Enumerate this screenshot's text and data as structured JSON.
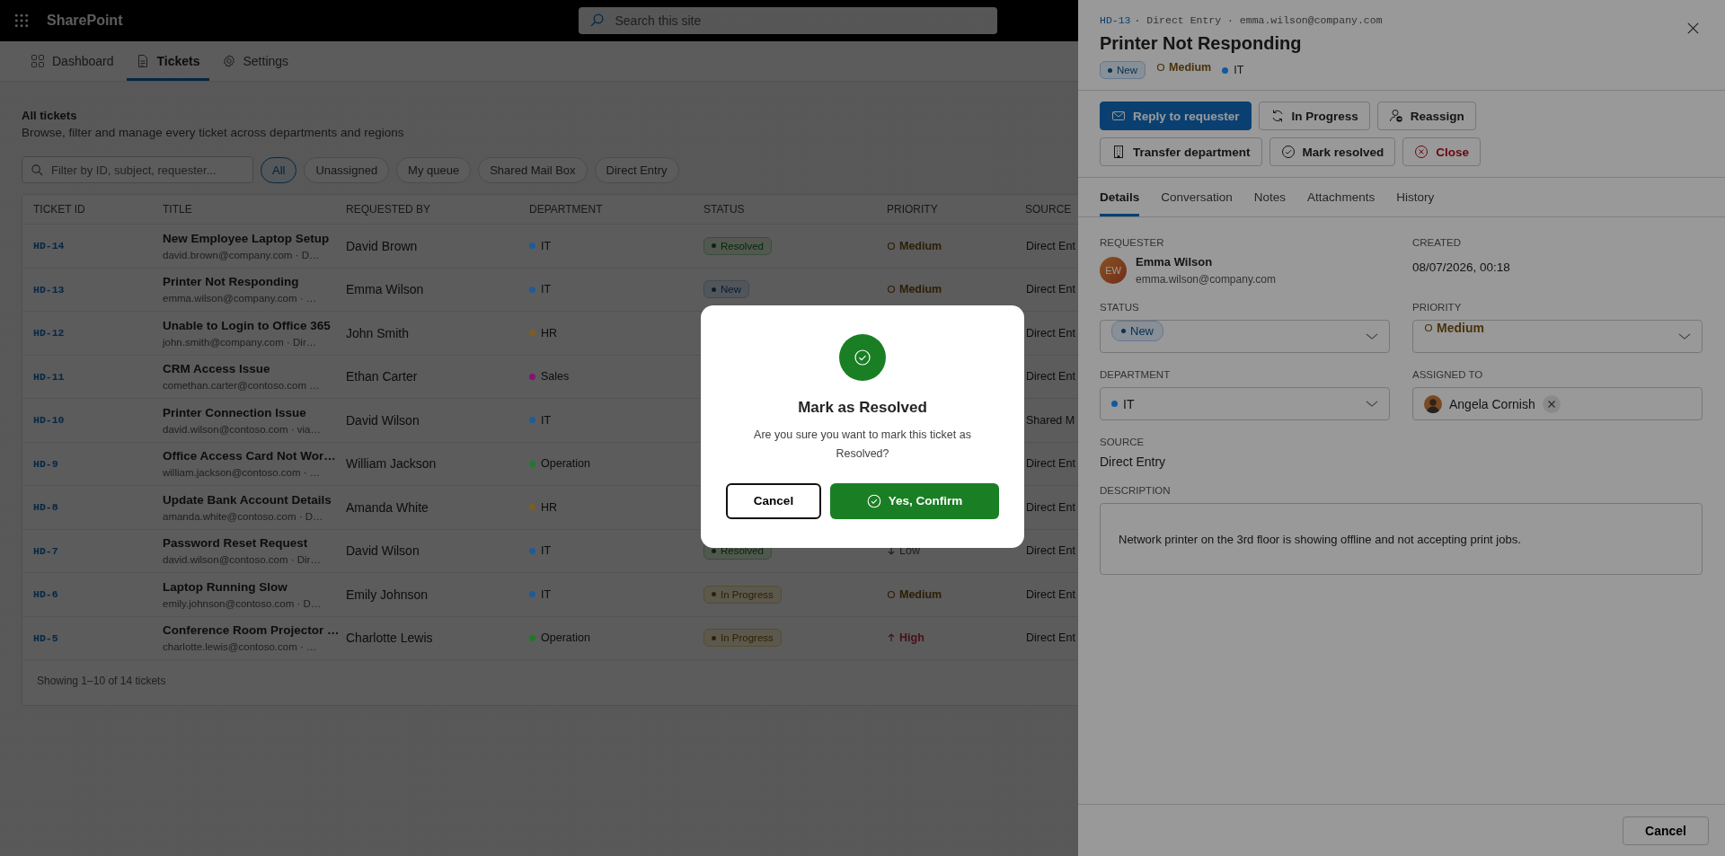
{
  "app_bar": {
    "app_name": "SharePoint",
    "search": {
      "placeholder": "Search this site"
    }
  },
  "nav_tabs": [
    {
      "label": "Dashboard",
      "kind": "dashboard",
      "selected": false
    },
    {
      "label": "Tickets",
      "kind": "tickets",
      "selected": true
    },
    {
      "label": "Settings",
      "kind": "settings",
      "selected": false
    }
  ],
  "page": {
    "title": "All tickets",
    "subtitle": "Browse, filter and manage every ticket across departments and regions"
  },
  "filter": {
    "placeholder": "Filter by ID, subject, requester..."
  },
  "chips": [
    {
      "label": "All",
      "selected": true
    },
    {
      "label": "Unassigned",
      "selected": false
    },
    {
      "label": "My queue",
      "selected": false
    },
    {
      "label": "Shared Mail Box",
      "selected": false
    },
    {
      "label": "Direct Entry",
      "selected": false
    }
  ],
  "table": {
    "columns": [
      "TICKET ID",
      "TITLE",
      "REQUESTED BY",
      "DEPARTMENT",
      "STATUS",
      "PRIORITY",
      "SOURCE"
    ],
    "rows": [
      {
        "id": "HD-14",
        "title": "New Employee Laptop Setup",
        "subtitle": "david.brown@company.com · D…",
        "requested_by": "David Brown",
        "department": {
          "label": "IT",
          "color": "#1d5c99"
        },
        "status": {
          "label": "Resolved",
          "kind": "resolved"
        },
        "priority": {
          "label": "Medium",
          "kind": "medium"
        },
        "source": "Direct Ent"
      },
      {
        "id": "HD-13",
        "title": "Printer Not Responding",
        "subtitle": "emma.wilson@company.com · …",
        "requested_by": "Emma Wilson",
        "department": {
          "label": "IT",
          "color": "#1d5c99"
        },
        "status": {
          "label": "New",
          "kind": "new"
        },
        "priority": {
          "label": "Medium",
          "kind": "medium"
        },
        "source": "Direct Ent"
      },
      {
        "id": "HD-12",
        "title": "Unable to Login to Office 365",
        "subtitle": "john.smith@company.com · Dir…",
        "requested_by": "John Smith",
        "department": {
          "label": "HR",
          "color": "#7a6020"
        },
        "source": "Direct Ent"
      },
      {
        "id": "HD-11",
        "title": "CRM Access Issue",
        "subtitle": "comethan.carter@contoso.com …",
        "requested_by": "Ethan Carter",
        "department": {
          "label": "Sales",
          "color": "#8a1070"
        },
        "source": "Direct Ent"
      },
      {
        "id": "HD-10",
        "title": "Printer Connection Issue",
        "subtitle": "david.wilson@contoso.com · via…",
        "requested_by": "David Wilson",
        "department": {
          "label": "IT",
          "color": "#1d5c99"
        },
        "source": "Shared M"
      },
      {
        "id": "HD-9",
        "title": "Office Access Card Not Wor…",
        "subtitle": "william.jackson@contoso.com · …",
        "requested_by": "William Jackson",
        "department": {
          "label": "Operation",
          "color": "#1d7a2a"
        },
        "source": "Direct Ent"
      },
      {
        "id": "HD-8",
        "title": "Update Bank Account Details",
        "subtitle": "amanda.white@contoso.com · D…",
        "requested_by": "Amanda White",
        "department": {
          "label": "HR",
          "color": "#7a6020"
        },
        "source": "Direct Ent"
      },
      {
        "id": "HD-7",
        "title": "Password Reset Request",
        "subtitle": "david.wilson@contoso.com · Dir…",
        "requested_by": "David Wilson",
        "department": {
          "label": "IT",
          "color": "#1d5c99"
        },
        "status": {
          "label": "Resolved",
          "kind": "resolved"
        },
        "priority": {
          "label": "Low",
          "kind": "low"
        },
        "source": "Direct Ent"
      },
      {
        "id": "HD-6",
        "title": "Laptop Running Slow",
        "subtitle": "emily.johnson@contoso.com · D…",
        "requested_by": "Emily Johnson",
        "department": {
          "label": "IT",
          "color": "#1d5c99"
        },
        "status": {
          "label": "In Progress",
          "kind": "in_progress"
        },
        "priority": {
          "label": "Medium",
          "kind": "medium"
        },
        "source": "Direct Ent"
      },
      {
        "id": "HD-5",
        "title": "Conference Room Projector …",
        "subtitle": "charlotte.lewis@contoso.com · …",
        "requested_by": "Charlotte Lewis",
        "department": {
          "label": "Operation",
          "color": "#1d7a2a"
        },
        "status": {
          "label": "In Progress",
          "kind": "in_progress"
        },
        "priority": {
          "label": "High",
          "kind": "high"
        },
        "source": "Direct Ent"
      }
    ],
    "footer": "Showing 1–10 of 14 tickets"
  },
  "drawer": {
    "ticket_id": "HD-13",
    "meta": "· Direct Entry · emma.wilson@company.com",
    "title": "Printer Not Responding",
    "badges": {
      "status": {
        "label": "New",
        "kind": "new"
      },
      "priority": {
        "label": "Medium",
        "kind": "medium"
      },
      "department": {
        "label": "IT",
        "color": "#0f5aa0"
      }
    },
    "actions": [
      {
        "label": "Reply to requester",
        "kind": "reply"
      },
      {
        "label": "In Progress",
        "kind": "progress"
      },
      {
        "label": "Reassign",
        "kind": "reassign"
      },
      {
        "label": "Transfer department",
        "kind": "transfer"
      },
      {
        "label": "Mark resolved",
        "kind": "resolve"
      },
      {
        "label": "Close",
        "kind": "close"
      }
    ],
    "tabs": [
      {
        "label": "Details",
        "selected": true
      },
      {
        "label": "Conversation",
        "selected": false
      },
      {
        "label": "Notes",
        "selected": false
      },
      {
        "label": "Attachments",
        "selected": false
      },
      {
        "label": "History",
        "selected": false
      }
    ],
    "requester": {
      "label": "REQUESTER",
      "initials": "EW",
      "name": "Emma Wilson",
      "email": "emma.wilson@company.com"
    },
    "created": {
      "label": "CREATED",
      "value": "08/07/2026, 00:18"
    },
    "status": {
      "label": "STATUS",
      "value": {
        "label": "New",
        "kind": "new"
      }
    },
    "priority": {
      "label": "PRIORITY",
      "value": {
        "label": "Medium",
        "kind": "medium"
      }
    },
    "department": {
      "label": "DEPARTMENT",
      "value": {
        "label": "IT",
        "color": "#0f5aa0"
      }
    },
    "assigned_to": {
      "label": "ASSIGNED TO",
      "name": "Angela Cornish"
    },
    "source": {
      "label": "SOURCE",
      "value": "Direct Entry"
    },
    "description": {
      "label": "DESCRIPTION",
      "value": "Network printer on the 3rd floor is showing offline and not accepting print jobs."
    },
    "footer_button": "Cancel"
  },
  "dialog": {
    "title": "Mark as Resolved",
    "message": "Are you sure you want to mark this ticket as Resolved?",
    "cancel": "Cancel",
    "confirm": "Yes, Confirm"
  }
}
